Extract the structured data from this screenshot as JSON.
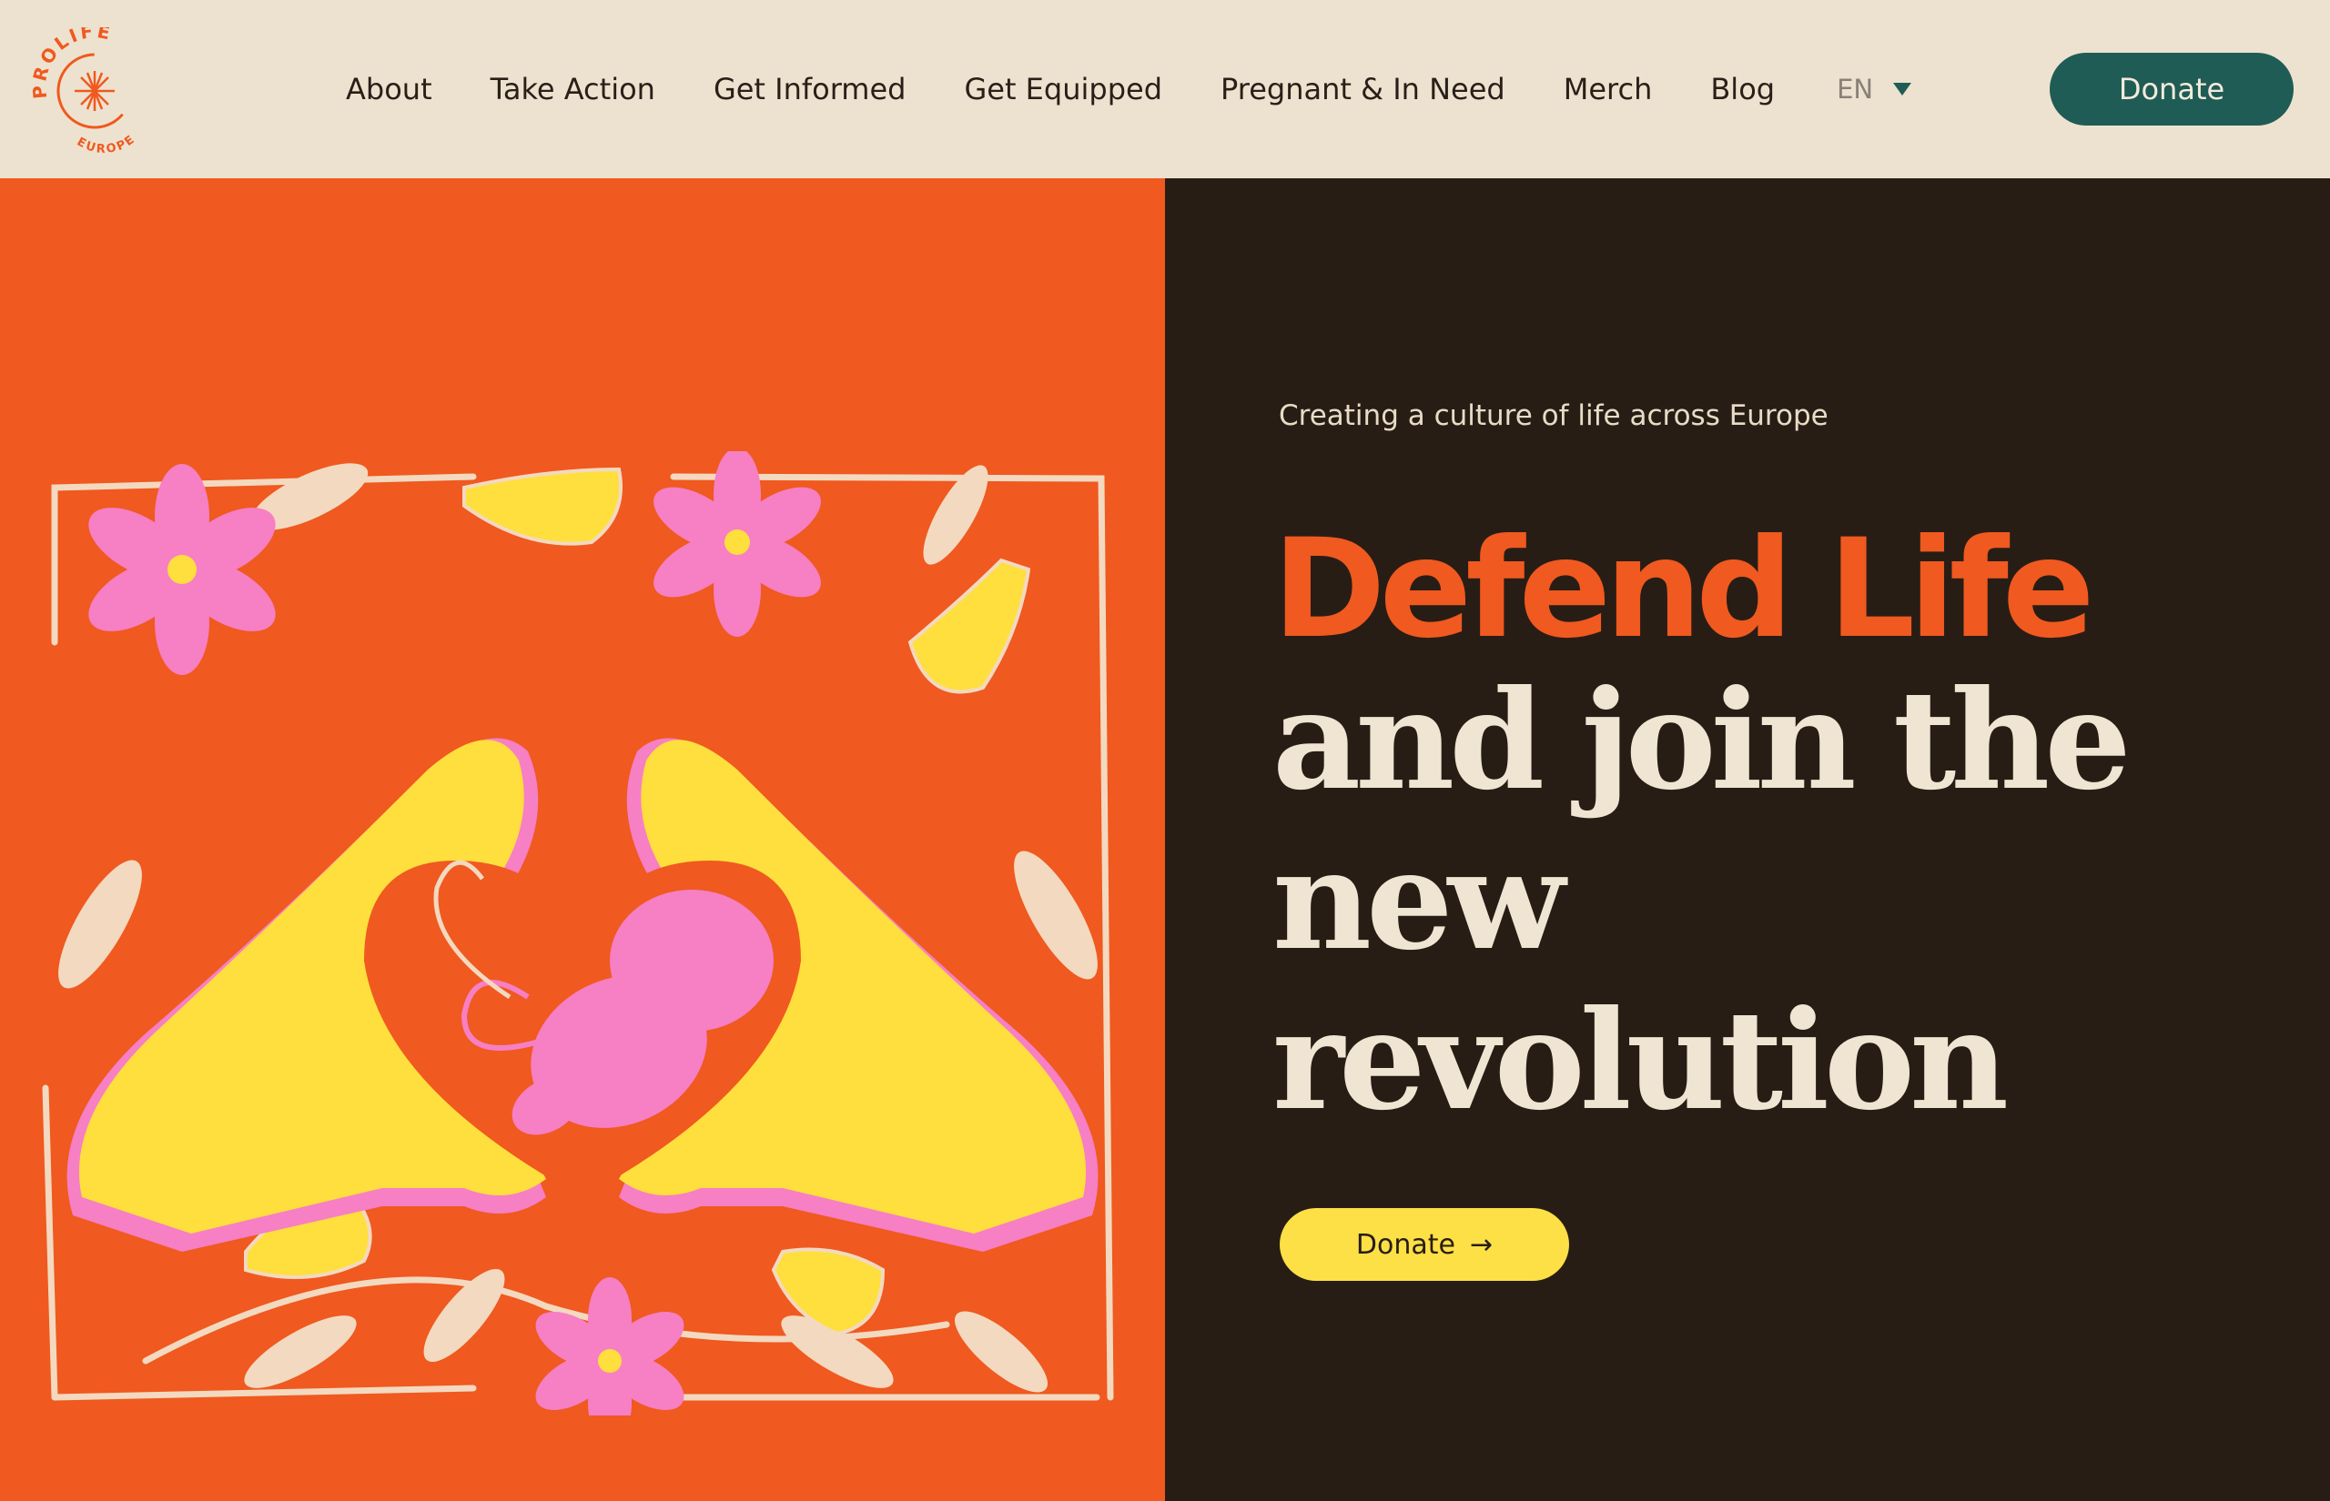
{
  "brand": {
    "logo_text_top": "PROLIFE",
    "logo_text_bottom": "EUROPE",
    "primary_color": "#f0591f",
    "dark_color": "#281d15",
    "accent_green": "#1f5c55",
    "accent_yellow": "#fde046",
    "cream": "#ede2cf"
  },
  "nav": {
    "items": [
      {
        "label": "About"
      },
      {
        "label": "Take Action"
      },
      {
        "label": "Get Informed"
      },
      {
        "label": "Get Equipped"
      },
      {
        "label": "Pregnant & In Need"
      },
      {
        "label": "Merch"
      },
      {
        "label": "Blog"
      }
    ],
    "language": "EN",
    "donate_label": "Donate"
  },
  "hero": {
    "tagline": "Creating a culture of life across Europe",
    "headline_accent": "Defend Life",
    "headline_rest": "and join the new revolution",
    "cta_label": "Donate",
    "cta_icon": "arrow-right-icon",
    "illustration": "heart-hands-illustration"
  }
}
